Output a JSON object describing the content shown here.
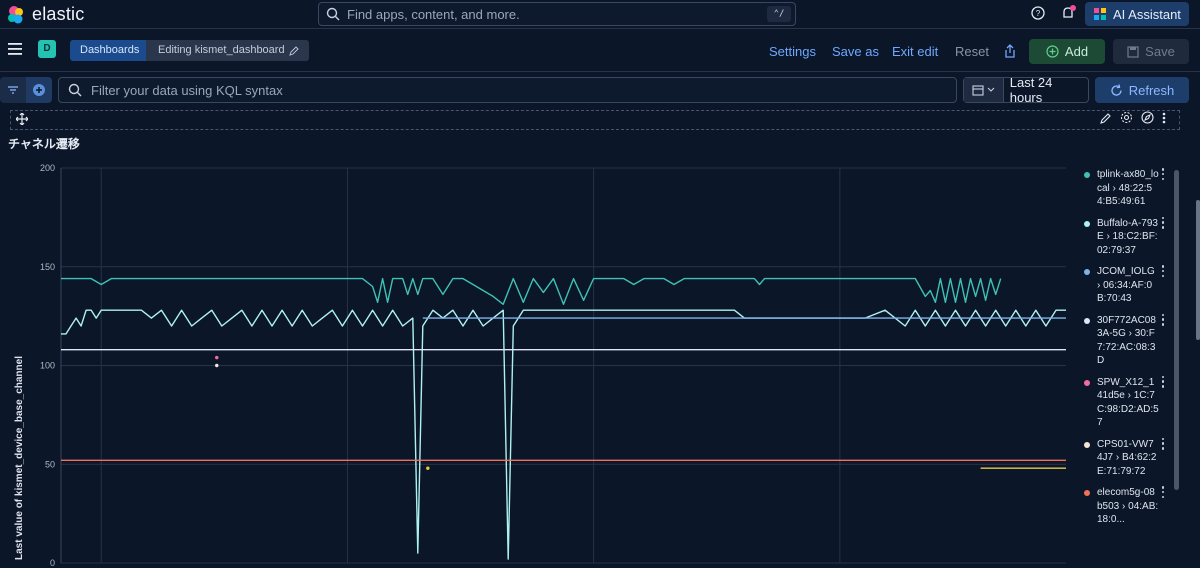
{
  "app": {
    "brand": "elastic",
    "search_placeholder": "Find apps, content, and more.",
    "search_shortcut": "⌃/",
    "ai_assistant_label": "AI Assistant"
  },
  "nav": {
    "space_initial": "D",
    "breadcrumbs": [
      "Dashboards",
      "Editing kismet_dashboard"
    ],
    "links": [
      "Settings",
      "Save as",
      "Exit edit",
      "Reset"
    ],
    "add_label": "Add",
    "save_label": "Save"
  },
  "filter": {
    "kql_placeholder": "Filter your data using KQL syntax",
    "time_range": "Last 24 hours",
    "refresh_label": "Refresh"
  },
  "panel": {
    "title": "チャネル遷移"
  },
  "chart_data": {
    "type": "line",
    "title": "",
    "xlabel": "",
    "ylabel": "Last value of kismet_device_base_channel",
    "ylim": [
      0,
      200
    ],
    "yticks": [
      0,
      50,
      100,
      150,
      200
    ],
    "grid": true,
    "legend_placement": "right",
    "x_domain": [
      0,
      100
    ],
    "series": [
      {
        "name": "tplink-ax80_local › 48:22:54:B5:49:61",
        "color": "#3fc1b5",
        "points": [
          [
            0,
            144
          ],
          [
            3,
            144
          ],
          [
            4,
            141
          ],
          [
            5,
            144
          ],
          [
            30,
            144
          ],
          [
            31,
            140
          ],
          [
            31.5,
            132
          ],
          [
            32,
            144
          ],
          [
            32.5,
            132
          ],
          [
            33,
            144
          ],
          [
            34,
            144
          ],
          [
            34.5,
            136
          ],
          [
            35,
            144
          ],
          [
            35.5,
            136
          ],
          [
            36,
            144
          ],
          [
            37,
            144
          ],
          [
            38,
            136
          ],
          [
            39,
            144
          ],
          [
            40,
            144
          ],
          [
            41,
            141
          ],
          [
            42,
            138
          ],
          [
            43,
            135
          ],
          [
            44,
            131
          ],
          [
            45,
            144
          ],
          [
            46,
            132
          ],
          [
            47,
            144
          ],
          [
            48,
            137
          ],
          [
            49,
            144
          ],
          [
            50,
            131
          ],
          [
            51,
            144
          ],
          [
            52,
            133
          ],
          [
            53,
            144
          ],
          [
            54,
            144
          ],
          [
            55,
            144
          ],
          [
            56,
            144
          ],
          [
            57,
            141
          ],
          [
            58,
            144
          ],
          [
            60,
            144
          ],
          [
            61,
            141
          ],
          [
            62,
            144
          ],
          [
            69,
            144
          ],
          [
            69.5,
            141
          ],
          [
            70,
            144
          ],
          [
            85,
            144
          ],
          [
            86,
            135
          ],
          [
            86.5,
            138
          ],
          [
            87,
            132
          ],
          [
            87.5,
            144
          ],
          [
            88,
            132
          ],
          [
            88.5,
            144
          ],
          [
            89,
            132
          ],
          [
            89.5,
            144
          ],
          [
            90,
            132
          ],
          [
            90.5,
            144
          ],
          [
            91,
            135
          ],
          [
            91.5,
            144
          ],
          [
            92,
            133
          ],
          [
            92.5,
            144
          ],
          [
            93,
            136
          ],
          [
            93.5,
            144
          ]
        ]
      },
      {
        "name": "Buffalo-A-793E › 18:C2:BF:02:79:37",
        "color": "#aef2f0",
        "points": [
          [
            0,
            116
          ],
          [
            0.5,
            116
          ],
          [
            1,
            120
          ],
          [
            1.5,
            124
          ],
          [
            2,
            120
          ],
          [
            2.5,
            128
          ],
          [
            3,
            128
          ],
          [
            3.5,
            124
          ],
          [
            4,
            128
          ],
          [
            8,
            128
          ],
          [
            9,
            124
          ],
          [
            10,
            128
          ],
          [
            11,
            120
          ],
          [
            12,
            128
          ],
          [
            13,
            120
          ],
          [
            14,
            124
          ],
          [
            15,
            128
          ],
          [
            16,
            120
          ],
          [
            17,
            124
          ],
          [
            18,
            128
          ],
          [
            19,
            120
          ],
          [
            20,
            128
          ],
          [
            21,
            120
          ],
          [
            22,
            128
          ],
          [
            23,
            120
          ],
          [
            24,
            128
          ],
          [
            25,
            120
          ],
          [
            26,
            124
          ],
          [
            27,
            128
          ],
          [
            28,
            120
          ],
          [
            29,
            128
          ],
          [
            30,
            120
          ],
          [
            31,
            128
          ],
          [
            32,
            120
          ],
          [
            33,
            128
          ],
          [
            34,
            120
          ],
          [
            35,
            124
          ],
          [
            35.5,
            5
          ],
          [
            36,
            120
          ],
          [
            37,
            128
          ],
          [
            38,
            124
          ],
          [
            39,
            128
          ],
          [
            40,
            120
          ],
          [
            41,
            128
          ],
          [
            42,
            120
          ],
          [
            43,
            124
          ],
          [
            44,
            128
          ],
          [
            44.5,
            2
          ],
          [
            45,
            120
          ],
          [
            46,
            128
          ],
          [
            47,
            128
          ],
          [
            48,
            128
          ],
          [
            67,
            128
          ],
          [
            68,
            124
          ],
          [
            80,
            124
          ],
          [
            82,
            128
          ],
          [
            83,
            124
          ],
          [
            84,
            120
          ],
          [
            85,
            128
          ],
          [
            86,
            120
          ],
          [
            87,
            128
          ],
          [
            88,
            120
          ],
          [
            89,
            128
          ],
          [
            90,
            120
          ],
          [
            91,
            128
          ],
          [
            92,
            120
          ],
          [
            93,
            128
          ],
          [
            94,
            120
          ],
          [
            95,
            128
          ],
          [
            96,
            120
          ],
          [
            97,
            128
          ],
          [
            98,
            120
          ],
          [
            99,
            128
          ],
          [
            100,
            128
          ]
        ]
      },
      {
        "name": "JCOM_IOLG › 06:34:AF:0B:70:43",
        "color": "#7fb2e8",
        "points": [
          [
            36,
            124
          ],
          [
            100,
            124
          ]
        ]
      },
      {
        "name": "30F772AC083A-5G › 30:F7:72:AC:08:3D",
        "color": "#dfe5f5",
        "points": [
          [
            0,
            108
          ],
          [
            100,
            108
          ]
        ]
      },
      {
        "name": "SPW_X12_141d5e › 1C:7C:98:D2:AD:57",
        "color": "#ee6ea1",
        "points": [
          [
            15.5,
            104
          ]
        ]
      },
      {
        "name": "CPS01-VW74J7 › B4:62:2E:71:79:72",
        "color": "#f3e6d6",
        "points": [
          [
            15.5,
            100
          ]
        ]
      },
      {
        "name": "elecom5g-08b503 › 04:AB:18:0...",
        "color": "#f0705a",
        "points": [
          [
            0,
            52
          ],
          [
            100,
            52
          ]
        ]
      },
      {
        "name": "",
        "color": "#e6c84b",
        "points": [
          [
            91.5,
            48
          ],
          [
            100,
            48
          ]
        ]
      },
      {
        "name": "",
        "color": "#e6c84b",
        "points": [
          [
            36.5,
            48
          ]
        ]
      }
    ]
  }
}
